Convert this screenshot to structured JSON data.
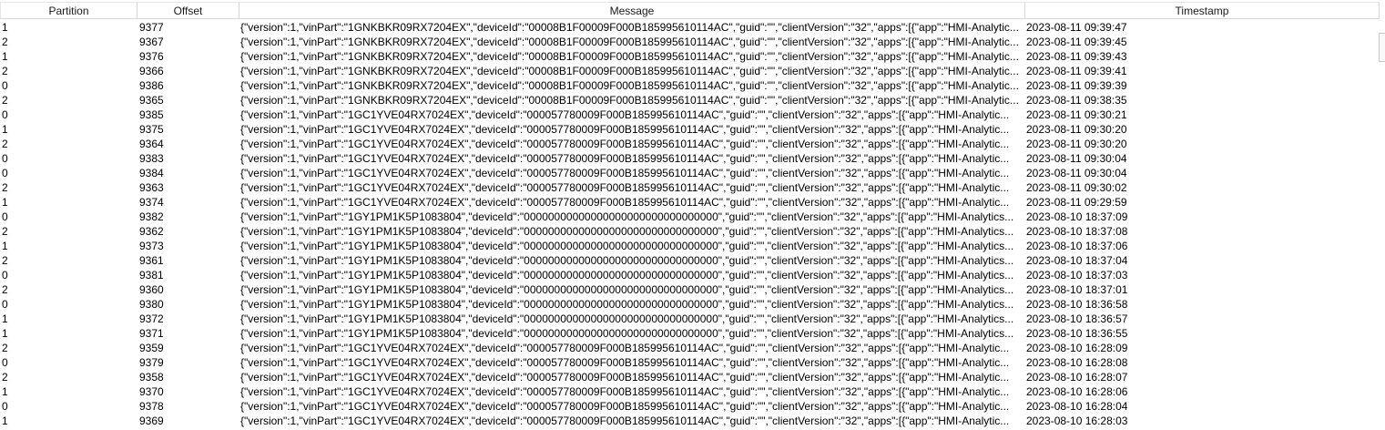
{
  "columns": {
    "partition": "Partition",
    "offset": "Offset",
    "message": "Message",
    "timestamp": "Timestamp"
  },
  "rows": [
    {
      "partition": "1",
      "offset": "9377",
      "message": "{\"version\":1,\"vinPart\":\"1GNKBKR09RX7204EX\",\"deviceId\":\"00008B1F00009F000B185995610114AC\",\"guid\":\"\",\"clientVersion\":\"32\",\"apps\":[{\"app\":\"HMI-Analytic...",
      "timestamp": "2023-08-11 09:39:47"
    },
    {
      "partition": "2",
      "offset": "9367",
      "message": "{\"version\":1,\"vinPart\":\"1GNKBKR09RX7204EX\",\"deviceId\":\"00008B1F00009F000B185995610114AC\",\"guid\":\"\",\"clientVersion\":\"32\",\"apps\":[{\"app\":\"HMI-Analytic...",
      "timestamp": "2023-08-11 09:39:45"
    },
    {
      "partition": "1",
      "offset": "9376",
      "message": "{\"version\":1,\"vinPart\":\"1GNKBKR09RX7204EX\",\"deviceId\":\"00008B1F00009F000B185995610114AC\",\"guid\":\"\",\"clientVersion\":\"32\",\"apps\":[{\"app\":\"HMI-Analytic...",
      "timestamp": "2023-08-11 09:39:43"
    },
    {
      "partition": "2",
      "offset": "9366",
      "message": "{\"version\":1,\"vinPart\":\"1GNKBKR09RX7204EX\",\"deviceId\":\"00008B1F00009F000B185995610114AC\",\"guid\":\"\",\"clientVersion\":\"32\",\"apps\":[{\"app\":\"HMI-Analytic...",
      "timestamp": "2023-08-11 09:39:41"
    },
    {
      "partition": "0",
      "offset": "9386",
      "message": "{\"version\":1,\"vinPart\":\"1GNKBKR09RX7204EX\",\"deviceId\":\"00008B1F00009F000B185995610114AC\",\"guid\":\"\",\"clientVersion\":\"32\",\"apps\":[{\"app\":\"HMI-Analytic...",
      "timestamp": "2023-08-11 09:39:39"
    },
    {
      "partition": "2",
      "offset": "9365",
      "message": "{\"version\":1,\"vinPart\":\"1GNKBKR09RX7204EX\",\"deviceId\":\"00008B1F00009F000B185995610114AC\",\"guid\":\"\",\"clientVersion\":\"32\",\"apps\":[{\"app\":\"HMI-Analytic...",
      "timestamp": "2023-08-11 09:38:35"
    },
    {
      "partition": "0",
      "offset": "9385",
      "message": "{\"version\":1,\"vinPart\":\"1GC1YVE04RX7024EX\",\"deviceId\":\"000057780009F000B185995610114AC\",\"guid\":\"\",\"clientVersion\":\"32\",\"apps\":[{\"app\":\"HMI-Analytic...",
      "timestamp": "2023-08-11 09:30:21"
    },
    {
      "partition": "1",
      "offset": "9375",
      "message": "{\"version\":1,\"vinPart\":\"1GC1YVE04RX7024EX\",\"deviceId\":\"000057780009F000B185995610114AC\",\"guid\":\"\",\"clientVersion\":\"32\",\"apps\":[{\"app\":\"HMI-Analytic...",
      "timestamp": "2023-08-11 09:30:20"
    },
    {
      "partition": "2",
      "offset": "9364",
      "message": "{\"version\":1,\"vinPart\":\"1GC1YVE04RX7024EX\",\"deviceId\":\"000057780009F000B185995610114AC\",\"guid\":\"\",\"clientVersion\":\"32\",\"apps\":[{\"app\":\"HMI-Analytic...",
      "timestamp": "2023-08-11 09:30:20"
    },
    {
      "partition": "0",
      "offset": "9383",
      "message": "{\"version\":1,\"vinPart\":\"1GC1YVE04RX7024EX\",\"deviceId\":\"000057780009F000B185995610114AC\",\"guid\":\"\",\"clientVersion\":\"32\",\"apps\":[{\"app\":\"HMI-Analytic...",
      "timestamp": "2023-08-11 09:30:04"
    },
    {
      "partition": "0",
      "offset": "9384",
      "message": "{\"version\":1,\"vinPart\":\"1GC1YVE04RX7024EX\",\"deviceId\":\"000057780009F000B185995610114AC\",\"guid\":\"\",\"clientVersion\":\"32\",\"apps\":[{\"app\":\"HMI-Analytic...",
      "timestamp": "2023-08-11 09:30:04"
    },
    {
      "partition": "2",
      "offset": "9363",
      "message": "{\"version\":1,\"vinPart\":\"1GC1YVE04RX7024EX\",\"deviceId\":\"000057780009F000B185995610114AC\",\"guid\":\"\",\"clientVersion\":\"32\",\"apps\":[{\"app\":\"HMI-Analytic...",
      "timestamp": "2023-08-11 09:30:02"
    },
    {
      "partition": "1",
      "offset": "9374",
      "message": "{\"version\":1,\"vinPart\":\"1GC1YVE04RX7024EX\",\"deviceId\":\"000057780009F000B185995610114AC\",\"guid\":\"\",\"clientVersion\":\"32\",\"apps\":[{\"app\":\"HMI-Analytic...",
      "timestamp": "2023-08-11 09:29:59"
    },
    {
      "partition": "0",
      "offset": "9382",
      "message": "{\"version\":1,\"vinPart\":\"1GY1PM1K5P1083804\",\"deviceId\":\"00000000000000000000000000000000\",\"guid\":\"\",\"clientVersion\":\"32\",\"apps\":[{\"app\":\"HMI-Analytics...",
      "timestamp": "2023-08-10 18:37:09"
    },
    {
      "partition": "2",
      "offset": "9362",
      "message": "{\"version\":1,\"vinPart\":\"1GY1PM1K5P1083804\",\"deviceId\":\"00000000000000000000000000000000\",\"guid\":\"\",\"clientVersion\":\"32\",\"apps\":[{\"app\":\"HMI-Analytics...",
      "timestamp": "2023-08-10 18:37:08"
    },
    {
      "partition": "1",
      "offset": "9373",
      "message": "{\"version\":1,\"vinPart\":\"1GY1PM1K5P1083804\",\"deviceId\":\"00000000000000000000000000000000\",\"guid\":\"\",\"clientVersion\":\"32\",\"apps\":[{\"app\":\"HMI-Analytics...",
      "timestamp": "2023-08-10 18:37:06"
    },
    {
      "partition": "2",
      "offset": "9361",
      "message": "{\"version\":1,\"vinPart\":\"1GY1PM1K5P1083804\",\"deviceId\":\"00000000000000000000000000000000\",\"guid\":\"\",\"clientVersion\":\"32\",\"apps\":[{\"app\":\"HMI-Analytics...",
      "timestamp": "2023-08-10 18:37:04"
    },
    {
      "partition": "0",
      "offset": "9381",
      "message": "{\"version\":1,\"vinPart\":\"1GY1PM1K5P1083804\",\"deviceId\":\"00000000000000000000000000000000\",\"guid\":\"\",\"clientVersion\":\"32\",\"apps\":[{\"app\":\"HMI-Analytics...",
      "timestamp": "2023-08-10 18:37:03"
    },
    {
      "partition": "2",
      "offset": "9360",
      "message": "{\"version\":1,\"vinPart\":\"1GY1PM1K5P1083804\",\"deviceId\":\"00000000000000000000000000000000\",\"guid\":\"\",\"clientVersion\":\"32\",\"apps\":[{\"app\":\"HMI-Analytics...",
      "timestamp": "2023-08-10 18:37:01"
    },
    {
      "partition": "0",
      "offset": "9380",
      "message": "{\"version\":1,\"vinPart\":\"1GY1PM1K5P1083804\",\"deviceId\":\"00000000000000000000000000000000\",\"guid\":\"\",\"clientVersion\":\"32\",\"apps\":[{\"app\":\"HMI-Analytics...",
      "timestamp": "2023-08-10 18:36:58"
    },
    {
      "partition": "1",
      "offset": "9372",
      "message": "{\"version\":1,\"vinPart\":\"1GY1PM1K5P1083804\",\"deviceId\":\"00000000000000000000000000000000\",\"guid\":\"\",\"clientVersion\":\"32\",\"apps\":[{\"app\":\"HMI-Analytics...",
      "timestamp": "2023-08-10 18:36:57"
    },
    {
      "partition": "1",
      "offset": "9371",
      "message": "{\"version\":1,\"vinPart\":\"1GY1PM1K5P1083804\",\"deviceId\":\"00000000000000000000000000000000\",\"guid\":\"\",\"clientVersion\":\"32\",\"apps\":[{\"app\":\"HMI-Analytics...",
      "timestamp": "2023-08-10 18:36:55"
    },
    {
      "partition": "2",
      "offset": "9359",
      "message": "{\"version\":1,\"vinPart\":\"1GC1YVE04RX7024EX\",\"deviceId\":\"000057780009F000B185995610114AC\",\"guid\":\"\",\"clientVersion\":\"32\",\"apps\":[{\"app\":\"HMI-Analytic...",
      "timestamp": "2023-08-10 16:28:09"
    },
    {
      "partition": "0",
      "offset": "9379",
      "message": "{\"version\":1,\"vinPart\":\"1GC1YVE04RX7024EX\",\"deviceId\":\"000057780009F000B185995610114AC\",\"guid\":\"\",\"clientVersion\":\"32\",\"apps\":[{\"app\":\"HMI-Analytic...",
      "timestamp": "2023-08-10 16:28:08"
    },
    {
      "partition": "2",
      "offset": "9358",
      "message": "{\"version\":1,\"vinPart\":\"1GC1YVE04RX7024EX\",\"deviceId\":\"000057780009F000B185995610114AC\",\"guid\":\"\",\"clientVersion\":\"32\",\"apps\":[{\"app\":\"HMI-Analytic...",
      "timestamp": "2023-08-10 16:28:07"
    },
    {
      "partition": "1",
      "offset": "9370",
      "message": "{\"version\":1,\"vinPart\":\"1GC1YVE04RX7024EX\",\"deviceId\":\"000057780009F000B185995610114AC\",\"guid\":\"\",\"clientVersion\":\"32\",\"apps\":[{\"app\":\"HMI-Analytic...",
      "timestamp": "2023-08-10 16:28:06"
    },
    {
      "partition": "0",
      "offset": "9378",
      "message": "{\"version\":1,\"vinPart\":\"1GC1YVE04RX7024EX\",\"deviceId\":\"000057780009F000B185995610114AC\",\"guid\":\"\",\"clientVersion\":\"32\",\"apps\":[{\"app\":\"HMI-Analytic...",
      "timestamp": "2023-08-10 16:28:04"
    },
    {
      "partition": "1",
      "offset": "9369",
      "message": "{\"version\":1,\"vinPart\":\"1GC1YVE04RX7024EX\",\"deviceId\":\"000057780009F000B185995610114AC\",\"guid\":\"\",\"clientVersion\":\"32\",\"apps\":[{\"app\":\"HMI-Analytic...",
      "timestamp": "2023-08-10 16:28:03"
    }
  ]
}
